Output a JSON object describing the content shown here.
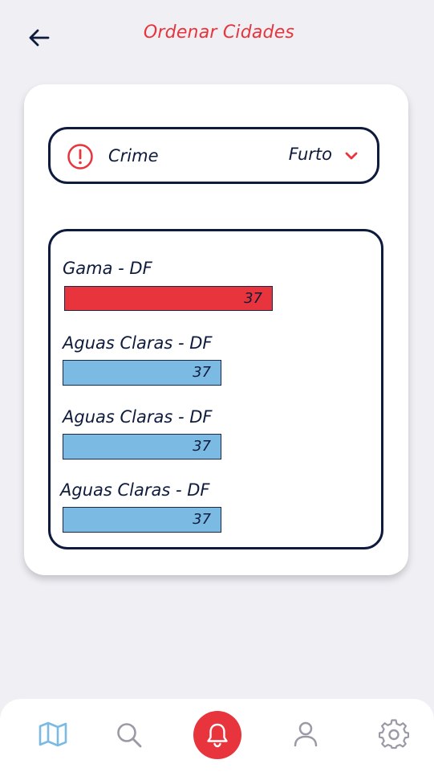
{
  "header": {
    "title": "Ordenar Cidades",
    "back_icon": "arrow-left-icon"
  },
  "filter": {
    "label": "Crime",
    "value": "Furto",
    "icon": "alert-circle-icon",
    "dropdown_icon": "chevron-down-icon"
  },
  "ranking": {
    "items": [
      {
        "name": "Gama - DF",
        "count": "37",
        "highlighted": true,
        "color": "#e8343c"
      },
      {
        "name": "Aguas Claras - DF",
        "count": "37",
        "highlighted": false,
        "color": "#7bbbe3"
      },
      {
        "name": "Aguas Claras - DF",
        "count": "37",
        "highlighted": false,
        "color": "#7bbbe3"
      },
      {
        "name": "Aguas Claras - DF",
        "count": "37",
        "highlighted": false,
        "color": "#7bbbe3"
      }
    ]
  },
  "nav": {
    "items": [
      {
        "icon": "map-icon",
        "active": true
      },
      {
        "icon": "search-icon",
        "active": false
      },
      {
        "icon": "bell-icon",
        "active": false
      },
      {
        "icon": "user-icon",
        "active": false
      },
      {
        "icon": "gear-icon",
        "active": false
      }
    ]
  },
  "colors": {
    "accent": "#e8343c",
    "ink": "#0e1b3d",
    "bar_blue": "#7bbbe3",
    "background": "#efeff4",
    "nav_active": "#7bbbe3",
    "nav_inactive": "#9a9aa6"
  }
}
